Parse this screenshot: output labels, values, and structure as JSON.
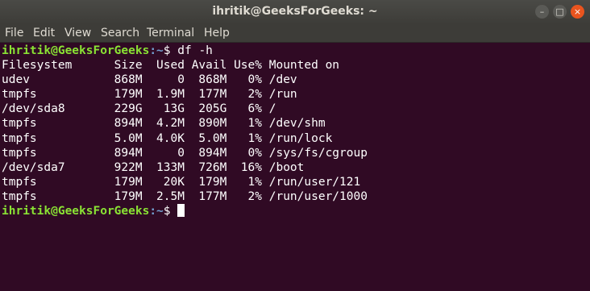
{
  "window": {
    "title": "ihritik@GeeksForGeeks: ~",
    "buttons": {
      "minimize": "–",
      "maximize": "□",
      "close": "×"
    }
  },
  "menubar": {
    "items": [
      "File",
      "Edit",
      "View",
      "Search",
      "Terminal",
      "Help"
    ]
  },
  "terminal": {
    "prompt_user": "ihritik@GeeksForGeeks",
    "prompt_path": ":~",
    "prompt_symbol": "$ ",
    "command": "df -h",
    "header": "Filesystem      Size  Used Avail Use% Mounted on",
    "rows": [
      "udev            868M     0  868M   0% /dev",
      "tmpfs           179M  1.9M  177M   2% /run",
      "/dev/sda8       229G   13G  205G   6% /",
      "tmpfs           894M  4.2M  890M   1% /dev/shm",
      "tmpfs           5.0M  4.0K  5.0M   1% /run/lock",
      "tmpfs           894M     0  894M   0% /sys/fs/cgroup",
      "/dev/sda7       922M  133M  726M  16% /boot",
      "tmpfs           179M   20K  179M   1% /run/user/121",
      "tmpfs           179M  2.5M  177M   2% /run/user/1000"
    ]
  },
  "colors": {
    "background": "#300a24",
    "prompt_user": "#8ae234",
    "prompt_path": "#729fcf",
    "close_button": "#e9541e"
  }
}
